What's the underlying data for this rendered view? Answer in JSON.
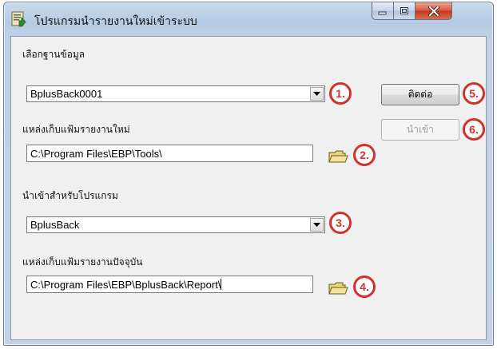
{
  "window": {
    "title": "โปรแกรมนำรายงานใหม่เข้าระบบ",
    "minimize_icon": "minimize-icon",
    "maximize_icon": "maximize-icon",
    "close_icon": "close-icon"
  },
  "form": {
    "database": {
      "label": "เลือกฐานข้อมูล",
      "value": "BplusBack0001",
      "badge": "1."
    },
    "new_report_location": {
      "label": "แหล่งเก็บแฟ้มรายงานใหม่",
      "value": "C:\\Program Files\\EBP\\Tools\\",
      "badge": "2."
    },
    "target_program": {
      "label": "นำเข้าสำหรับโปรแกรม",
      "value": "BplusBack",
      "badge": "3."
    },
    "current_report_location": {
      "label": "แหล่งเก็บแฟ้มรายงานปัจจุบัน",
      "value": "C:\\Program Files\\EBP\\BplusBack\\Report\\",
      "badge": "4."
    }
  },
  "buttons": {
    "connect": {
      "label": "ติดต่อ",
      "badge": "5."
    },
    "import": {
      "label": "นำเข้า",
      "badge": "6.",
      "enabled": false
    }
  },
  "colors": {
    "badge": "#d0322a",
    "title_bar": "#b4cbe3",
    "close_button": "#c2381c"
  }
}
